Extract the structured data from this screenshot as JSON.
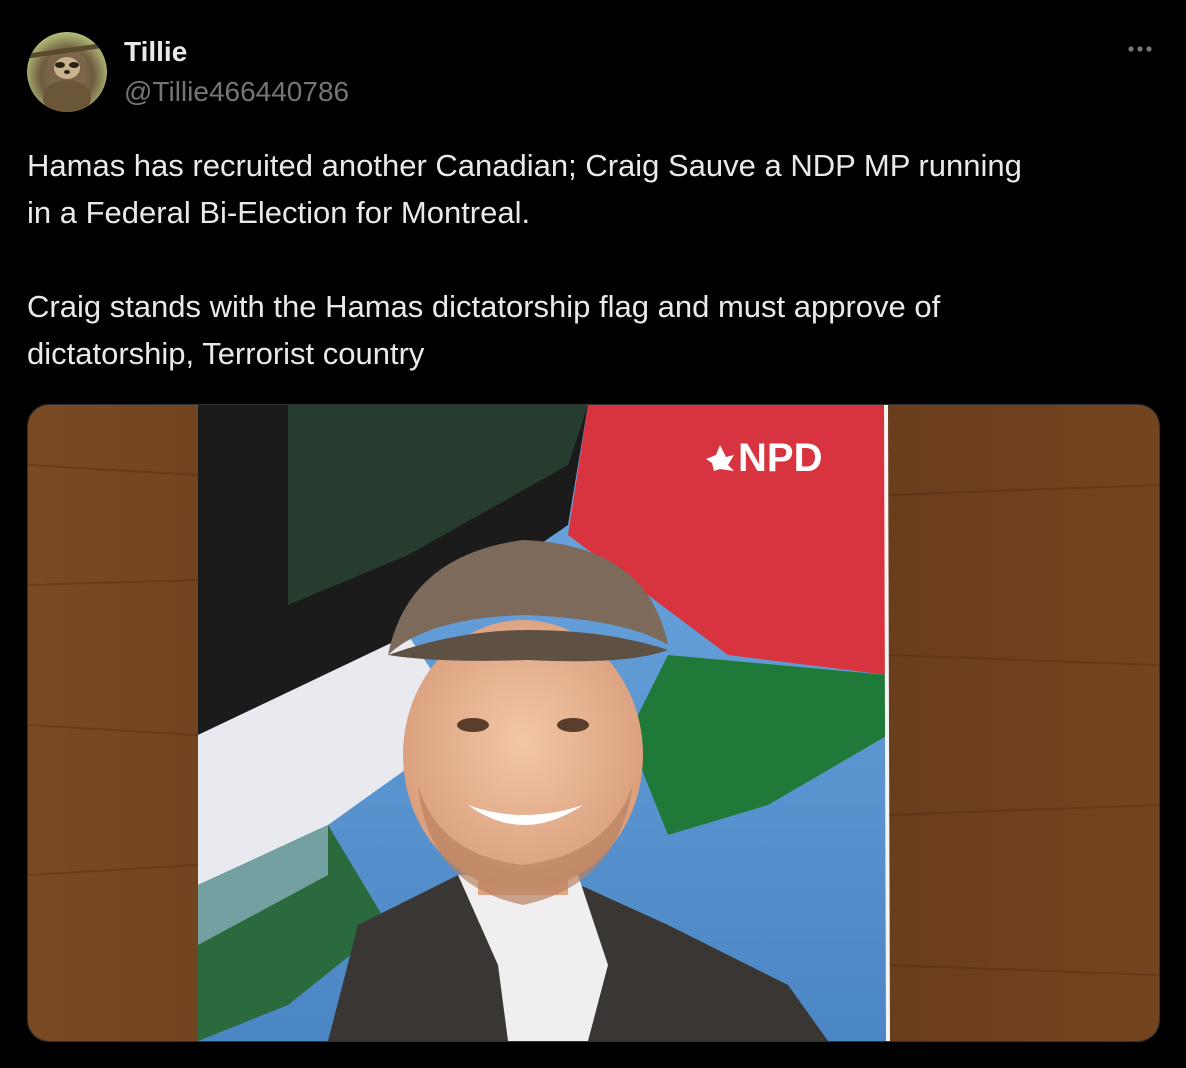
{
  "author": {
    "name": "Tillie",
    "handle": "@Tillie466440786",
    "avatar_icon": "sloth-avatar"
  },
  "more_icon": "more-horizontal-icon",
  "tweet": {
    "text": "Hamas has recruited another Canadian; Craig Sauve a NDP MP running\nin a Federal Bi-Election for Montreal.\n\nCraig stands with the Hamas dictatorship flag and must approve of\ndictatorship, Terrorist country"
  },
  "media": {
    "poster_logo_text": "NPD",
    "colors": {
      "wood": "#6b3f1d",
      "flag_red": "#d8343f",
      "flag_green": "#1f7a3a",
      "flag_black": "#1b1b1b",
      "flag_white": "#e8eaf0",
      "sky": "#5f9ad6",
      "cap": "#7d6a5b",
      "jacket": "#3a3634"
    }
  }
}
